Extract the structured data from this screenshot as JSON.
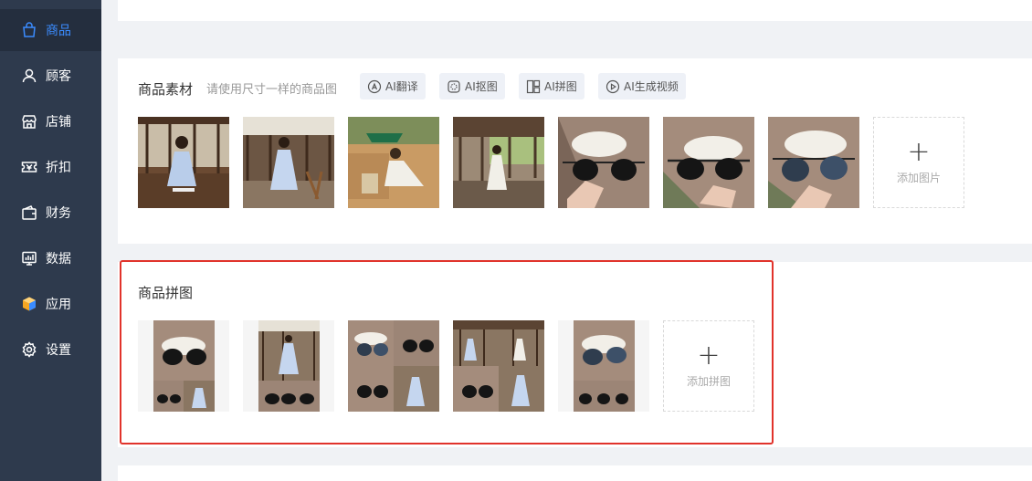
{
  "sidebar": {
    "items": [
      {
        "label": "商品",
        "icon": "shopping-bag-icon",
        "active": true
      },
      {
        "label": "顾客",
        "icon": "user-icon"
      },
      {
        "label": "店铺",
        "icon": "store-icon"
      },
      {
        "label": "折扣",
        "icon": "coupon-icon"
      },
      {
        "label": "财务",
        "icon": "wallet-icon"
      },
      {
        "label": "数据",
        "icon": "chart-icon"
      },
      {
        "label": "应用",
        "icon": "cube-icon"
      },
      {
        "label": "设置",
        "icon": "gear-icon"
      }
    ],
    "accent_color": "#3b8cff"
  },
  "material": {
    "title": "商品素材",
    "hint": "请使用尺寸一样的商品图",
    "ai_buttons": [
      {
        "label": "AI翻译",
        "icon": "translate-icon"
      },
      {
        "label": "AI抠图",
        "icon": "cutout-icon"
      },
      {
        "label": "AI拼图",
        "icon": "collage-icon"
      },
      {
        "label": "AI生成视频",
        "icon": "play-icon"
      }
    ],
    "images": [
      "dress-photo",
      "dress-photo",
      "dress-photo",
      "dress-photo",
      "sunglasses-photo",
      "sunglasses-photo",
      "sunglasses-photo"
    ],
    "add_label": "添加图片"
  },
  "collage": {
    "title": "商品拼图",
    "images": [
      "collage-photo",
      "collage-photo",
      "collage-photo",
      "collage-photo",
      "collage-photo"
    ],
    "add_label": "添加拼图"
  },
  "highlight_color": "#e1332b"
}
